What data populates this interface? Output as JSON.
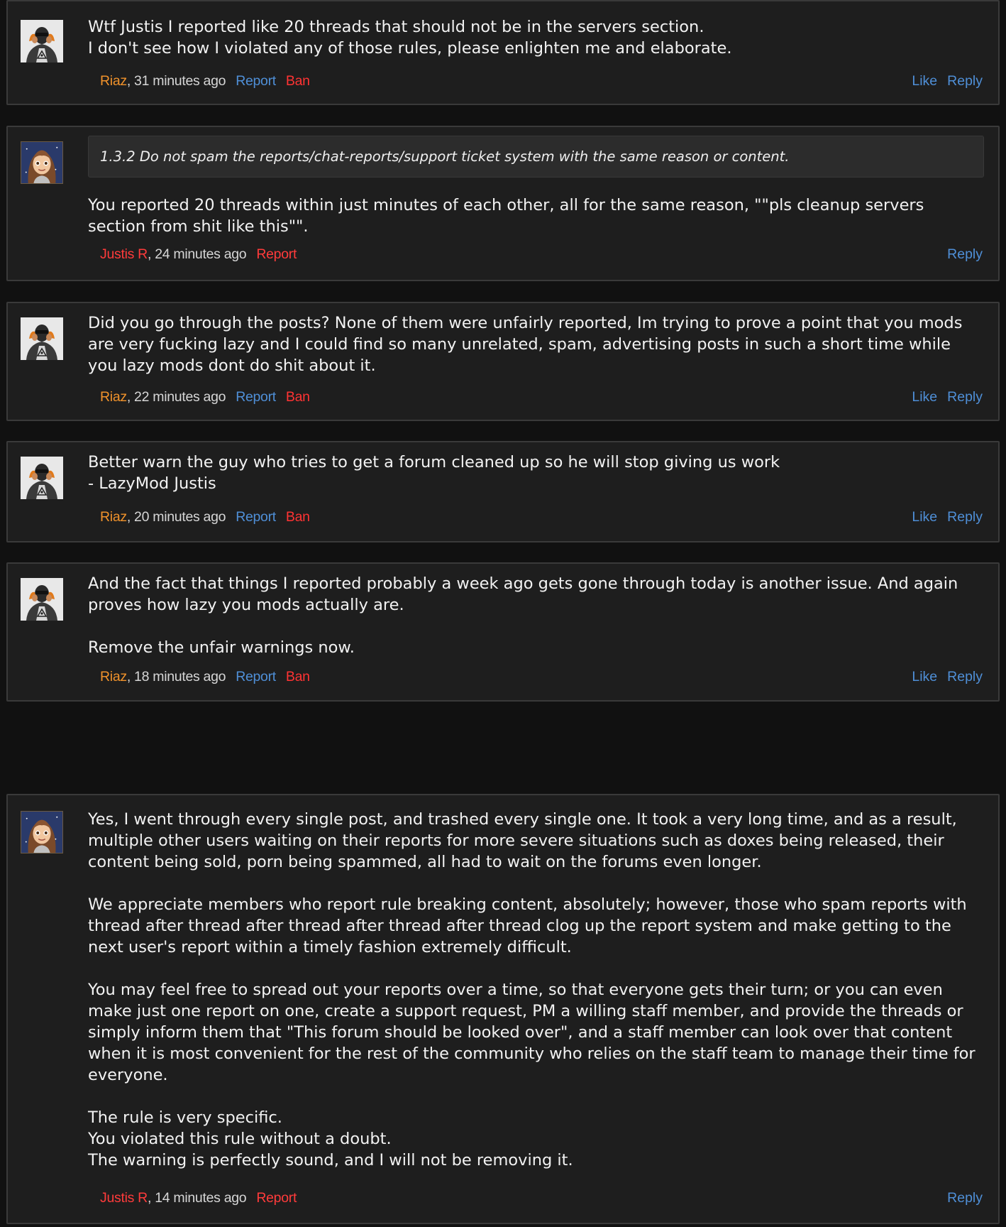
{
  "colors": {
    "page_background": "#111111",
    "post_background": "#1e1e1e",
    "text": "#f2f2f2",
    "author_riaz": "#f0922b",
    "author_justis": "#ff3b3b",
    "link": "#4f8fd7",
    "ban": "#ff3333"
  },
  "posts": [
    {
      "avatar_icon": "hooded-figure-avatar-icon",
      "paragraphs": [
        "Wtf Justis I reported like 20 threads that should not be in the servers section.\nI don't see how I violated any of those rules, please enlighten me and elaborate."
      ],
      "author": "Riaz",
      "time": ", 31 minutes ago",
      "report": "Report",
      "ban": "Ban",
      "like": "Like",
      "reply": "Reply"
    },
    {
      "avatar_icon": "long-haired-character-avatar-icon",
      "quote": "1.3.2 Do not spam the reports/chat-reports/support ticket system with the same reason or content.",
      "paragraphs": [
        "You reported 20 threads within just minutes of each other, all for the same reason, \"\"pls cleanup servers section from shit like this\"\"."
      ],
      "author": "Justis R",
      "time": ", 24 minutes ago",
      "report": "Report",
      "reply": "Reply"
    },
    {
      "avatar_icon": "hooded-figure-avatar-icon",
      "paragraphs": [
        "Did you go through the posts? None of them were unfairly reported, Im trying to prove a point that you mods are very fucking lazy and I could find so many unrelated, spam, advertising posts in such a short time while you lazy mods dont do shit about it."
      ],
      "author": "Riaz",
      "time": ", 22 minutes ago",
      "report": "Report",
      "ban": "Ban",
      "like": "Like",
      "reply": "Reply"
    },
    {
      "avatar_icon": "hooded-figure-avatar-icon",
      "paragraphs": [
        "Better warn the guy who tries to get a forum cleaned up so he will stop giving us work\n- LazyMod Justis"
      ],
      "author": "Riaz",
      "time": ", 20 minutes ago",
      "report": "Report",
      "ban": "Ban",
      "like": "Like",
      "reply": "Reply"
    },
    {
      "avatar_icon": "hooded-figure-avatar-icon",
      "paragraphs": [
        "And the fact that things I reported probably a week ago gets gone through today is another issue. And again proves how lazy you mods actually are.",
        "Remove the unfair warnings now."
      ],
      "author": "Riaz",
      "time": ", 18 minutes ago",
      "report": "Report",
      "ban": "Ban",
      "like": "Like",
      "reply": "Reply"
    },
    {
      "avatar_icon": "long-haired-character-avatar-icon",
      "paragraphs": [
        "Yes, I went through every single post, and trashed every single one. It took a very long time, and as a result, multiple other users waiting on their reports for more severe situations such as doxes being released, their content being sold, porn being spammed, all had to wait on the forums even longer.",
        "We appreciate members who report rule breaking content, absolutely; however, those who spam reports with thread after thread after thread after thread after thread clog up the report system and make getting to the next user's report within a timely fashion extremely difficult.",
        "You may feel free to spread out your reports over a time, so that everyone gets their turn; or you can even make just one report on one, create a support request, PM a willing staff member, and provide the threads or simply inform them that \"This forum should be looked over\", and a staff member can look over that content when it is most convenient for the rest of the community who relies on the staff team to manage their time for everyone.",
        "The rule is very specific.\nYou violated this rule without a doubt.\nThe warning is perfectly sound, and I will not be removing it."
      ],
      "author": "Justis R",
      "time": ", 14 minutes ago",
      "report": "Report",
      "reply": "Reply"
    }
  ]
}
